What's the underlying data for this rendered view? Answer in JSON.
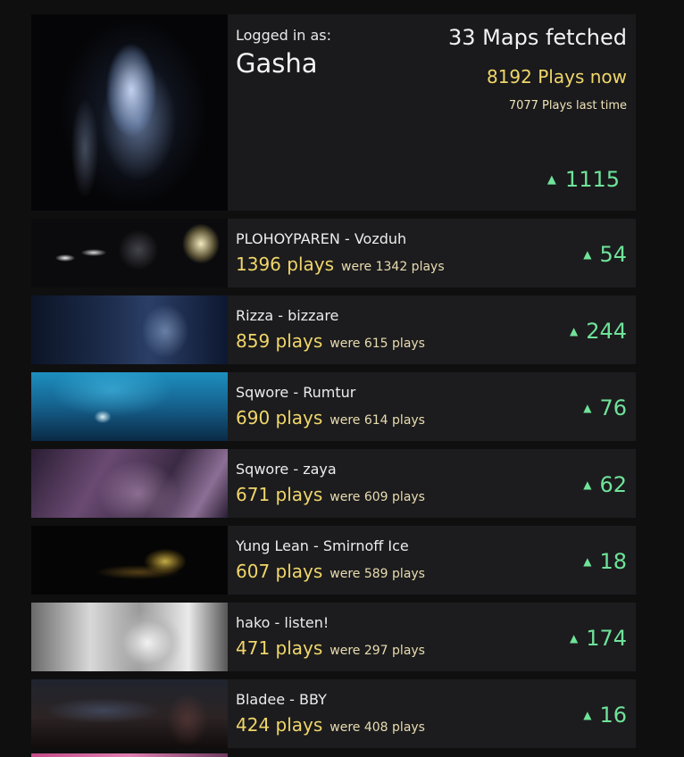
{
  "user": {
    "logged_in_label": "Logged in as:",
    "name": "Gasha",
    "maps_fetched": "33 Maps fetched",
    "plays_now": "8192 Plays now",
    "plays_last_time": "7077 Plays last time",
    "delta": "1115"
  },
  "colors": {
    "accent_gold": "#f0d66a",
    "delta_green": "#6fe39a",
    "card_bg": "#1c1c1e",
    "page_bg": "#0f0f10"
  },
  "up_icon": "▲",
  "maps": [
    {
      "title": "PLOHOYPAREN - Vozduh",
      "plays": "1396 plays",
      "were": "were 1342 plays",
      "delta": "54"
    },
    {
      "title": "Rizza - bizzare",
      "plays": "859 plays",
      "were": "were 615 plays",
      "delta": "244"
    },
    {
      "title": "Sqwore - Rumtur",
      "plays": "690 plays",
      "were": "were 614 plays",
      "delta": "76"
    },
    {
      "title": "Sqwore - zaya",
      "plays": "671 plays",
      "were": "were 609 plays",
      "delta": "62"
    },
    {
      "title": "Yung Lean - Smirnoff Ice",
      "plays": "607 plays",
      "were": "were 589 plays",
      "delta": "18"
    },
    {
      "title": "hako - listen!",
      "plays": "471 plays",
      "were": "were 297 plays",
      "delta": "174"
    },
    {
      "title": "Bladee - BBY",
      "plays": "424 plays",
      "were": "were 408 plays",
      "delta": "16"
    }
  ]
}
